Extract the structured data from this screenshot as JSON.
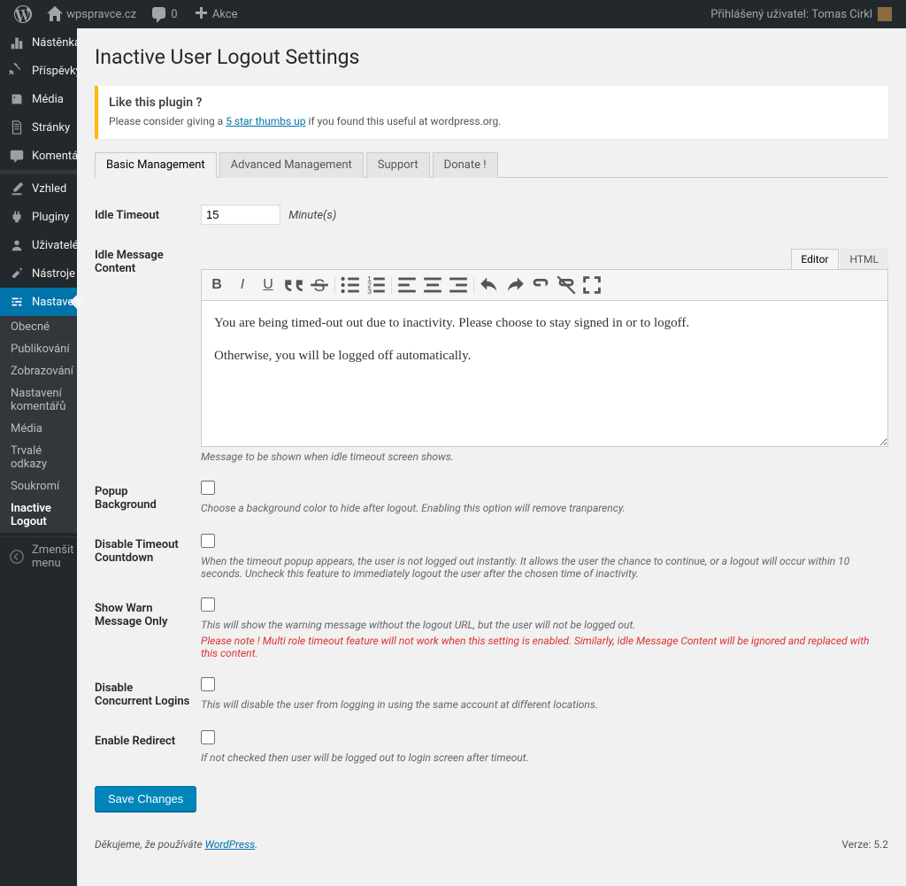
{
  "adminbar": {
    "site_name": "wpspravce.cz",
    "comments_count": "0",
    "new_label": "Akce",
    "user_greeting": "Přihlášený uživatel:",
    "user_name": "Tomas Cirkl"
  },
  "sidebar": {
    "items": [
      {
        "label": "Nástěnka",
        "icon": "dashboard"
      },
      {
        "label": "Příspěvky",
        "icon": "pin"
      },
      {
        "label": "Média",
        "icon": "media"
      },
      {
        "label": "Stránky",
        "icon": "page"
      },
      {
        "label": "Komentáře",
        "icon": "comment"
      },
      {
        "label": "Vzhled",
        "icon": "appearance"
      },
      {
        "label": "Pluginy",
        "icon": "plugin"
      },
      {
        "label": "Uživatelé",
        "icon": "user"
      },
      {
        "label": "Nástroje",
        "icon": "tools"
      },
      {
        "label": "Nastavení",
        "icon": "settings",
        "current": true
      }
    ],
    "submenu": [
      {
        "label": "Obecné"
      },
      {
        "label": "Publikování"
      },
      {
        "label": "Zobrazování"
      },
      {
        "label": "Nastavení komentářů"
      },
      {
        "label": "Média"
      },
      {
        "label": "Trvalé odkazy"
      },
      {
        "label": "Soukromí"
      },
      {
        "label": "Inactive Logout",
        "current": true
      }
    ],
    "collapse_label": "Zmenšit menu"
  },
  "page": {
    "title": "Inactive User Logout Settings",
    "notice_heading": "Like this plugin ?",
    "notice_pre": "Please consider giving a ",
    "notice_link": "5 star thumbs up",
    "notice_post": " if you found this useful at wordpress.org.",
    "tabs": [
      {
        "label": "Basic Management",
        "active": true
      },
      {
        "label": "Advanced Management"
      },
      {
        "label": "Support"
      },
      {
        "label": "Donate !"
      }
    ],
    "fields": {
      "idle_timeout": {
        "label": "Idle Timeout",
        "value": "15",
        "unit": "Minute(s)"
      },
      "idle_message": {
        "label": "Idle Message Content",
        "editor_tab_visual": "Editor",
        "editor_tab_text": "HTML",
        "body_p1": "You are being timed-out out due to inactivity. Please choose to stay signed in or to logoff.",
        "body_p2": "Otherwise, you will be logged off automatically.",
        "caption": "Message to be shown when idle timeout screen shows."
      },
      "popup_bg": {
        "label": "Popup Background",
        "desc": "Choose a background color to hide after logout. Enabling this option will remove tranparency."
      },
      "disable_countdown": {
        "label": "Disable Timeout Countdown",
        "desc": "When the timeout popup appears, the user is not logged out instantly. It allows the user the chance to continue, or a logout will occur within 10 seconds. Uncheck this feature to immediately logout the user after the chosen time of inactivity."
      },
      "warn_only": {
        "label": "Show Warn Message Only",
        "desc": "This will show the warning message without the logout URL, but the user will not be logged out.",
        "desc2": "Please note ! Multi role timeout feature will not work when this setting is enabled. Similarly, idle Message Content will be ignored and replaced with this content."
      },
      "concurrent": {
        "label": "Disable Concurrent Logins",
        "desc": "This will disable the user from logging in using the same account at different locations."
      },
      "redirect": {
        "label": "Enable Redirect",
        "desc": "If not checked then user will be logged out to login screen after timeout."
      }
    },
    "submit_label": "Save Changes",
    "footer_pre": "Děkujeme, že používáte ",
    "footer_link": "WordPress",
    "footer_post": ".",
    "version": "Verze: 5.2"
  }
}
